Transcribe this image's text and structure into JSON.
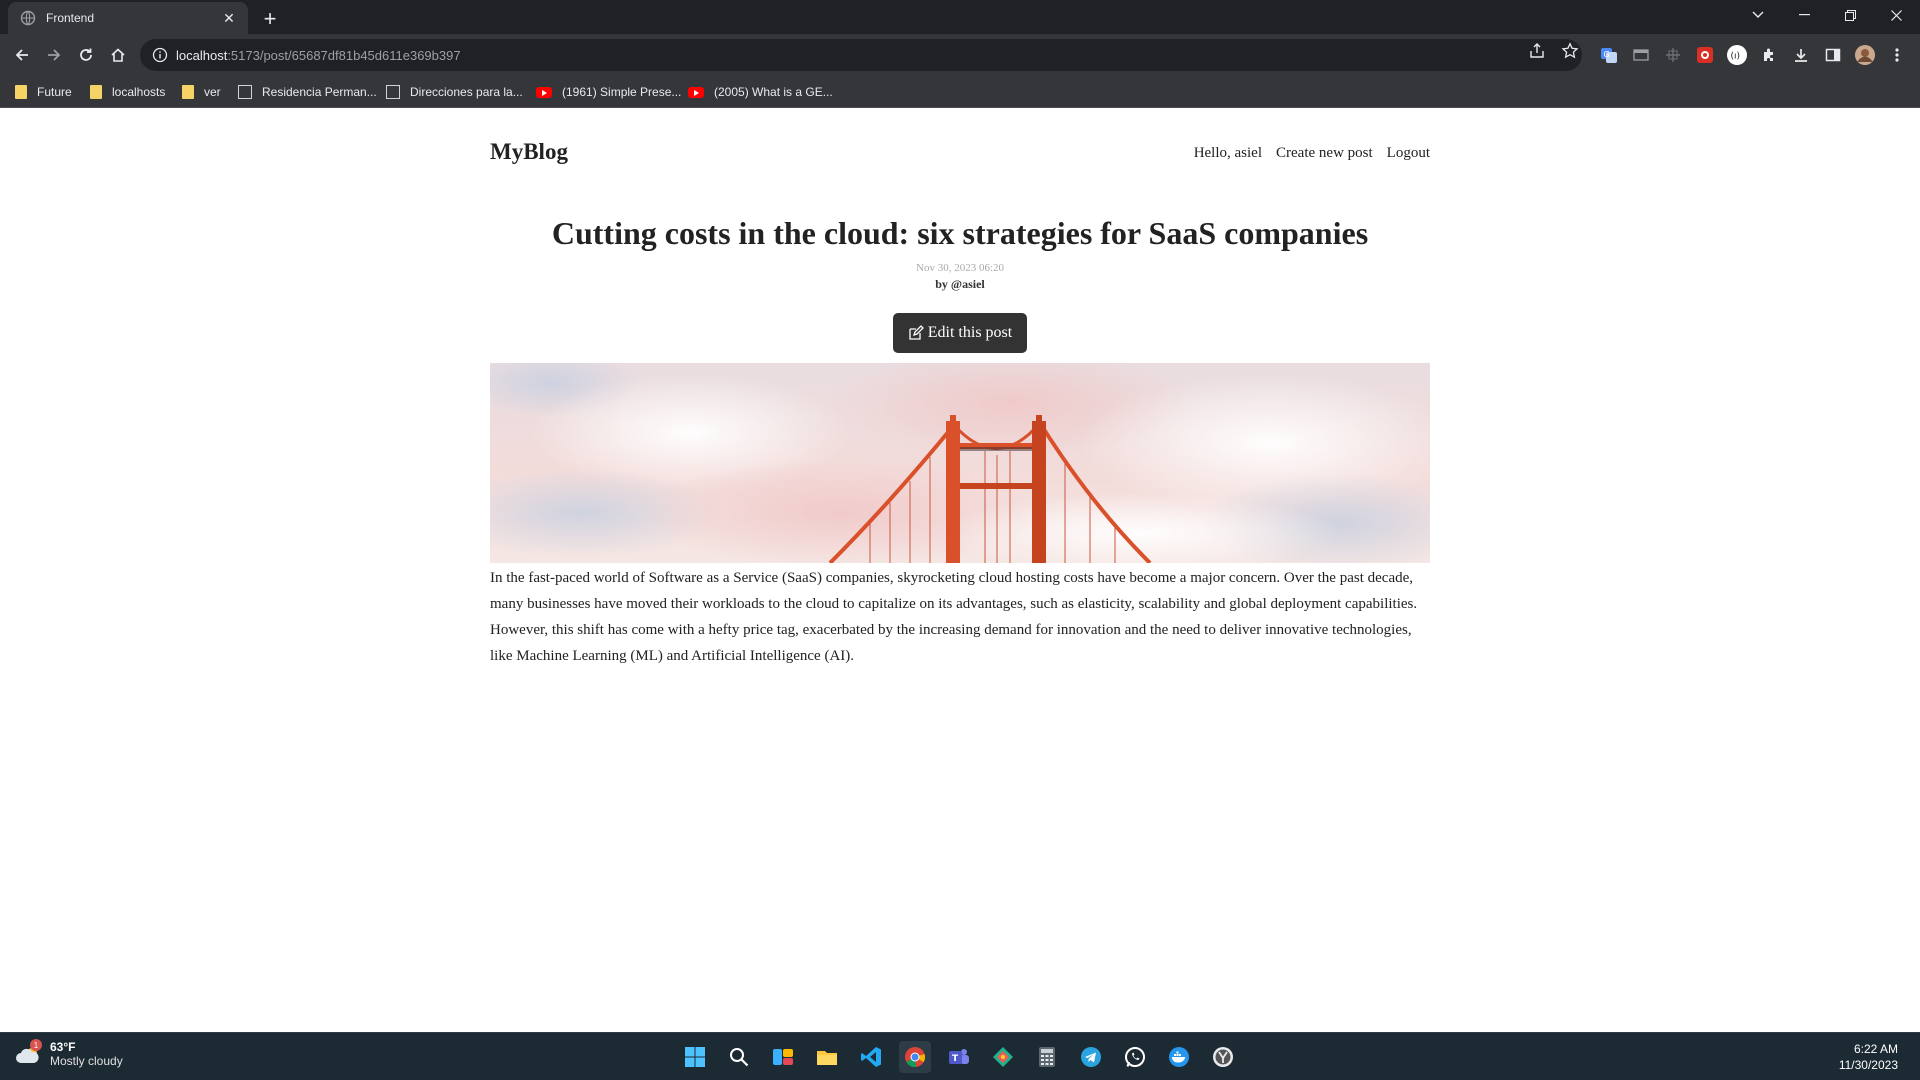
{
  "browser": {
    "tab_title": "Frontend",
    "tab_close": "✕",
    "new_tab": "+",
    "url_host": "localhost",
    "url_path": ":5173/post/65687df81b45d611e369b397",
    "bookmarks": [
      {
        "label": "Future",
        "icon": "folder-icon"
      },
      {
        "label": "localhosts",
        "icon": "folder-icon"
      },
      {
        "label": "ver",
        "icon": "folder-icon"
      },
      {
        "label": "Residencia Perman...",
        "icon": "doc-icon"
      },
      {
        "label": "Direcciones para la...",
        "icon": "doc-icon"
      },
      {
        "label": "(1961) Simple Prese...",
        "icon": "youtube-icon"
      },
      {
        "label": "(2005) What is a GE...",
        "icon": "youtube-icon"
      }
    ]
  },
  "site": {
    "logo": "MyBlog",
    "nav": {
      "greeting": "Hello, asiel",
      "create": "Create new post",
      "logout": "Logout"
    }
  },
  "post": {
    "title": "Cutting costs in the cloud: six strategies for SaaS companies",
    "date": "Nov 30, 2023 06:20",
    "author": "by @asiel",
    "edit_label": "Edit this post",
    "content": "In the fast-paced world of Software as a Service (SaaS) companies, skyrocketing cloud hosting costs have become a major concern. Over the past decade, many businesses have moved their workloads to the cloud to capitalize on its advantages, such as elasticity, scalability and global deployment capabilities. However, this shift has come with a hefty price tag, exacerbated by the increasing demand for innovation and the need to deliver innovative technologies, like Machine Learning (ML) and Artificial Intelligence (AI)."
  },
  "taskbar": {
    "weather_temp": "63°F",
    "weather_cond": "Mostly cloudy",
    "weather_badge": "1",
    "time": "6:22 AM",
    "date": "11/30/2023"
  },
  "colors": {
    "chrome_dark": "#202124",
    "chrome_toolbar": "#35363a",
    "taskbar": "#1c2a33",
    "button": "#333333",
    "bridge": "#d9502a"
  }
}
